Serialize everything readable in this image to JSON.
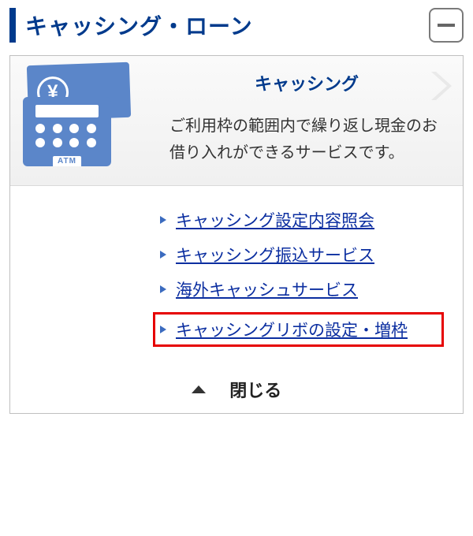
{
  "header": {
    "title": "キャッシング・ローン"
  },
  "section": {
    "title": "キャッシング",
    "description": "ご利用枠の範囲内で繰り返し現金のお借り入れができるサービスです。",
    "atm_label": "ATM",
    "yen_symbol": "¥"
  },
  "links": [
    {
      "label": "キャッシング設定内容照会",
      "highlight": false
    },
    {
      "label": "キャッシング振込サービス",
      "highlight": false
    },
    {
      "label": "海外キャッシュサービス",
      "highlight": false
    },
    {
      "label": "キャッシングリボの設定・増枠",
      "highlight": true
    }
  ],
  "close_label": "閉じる"
}
